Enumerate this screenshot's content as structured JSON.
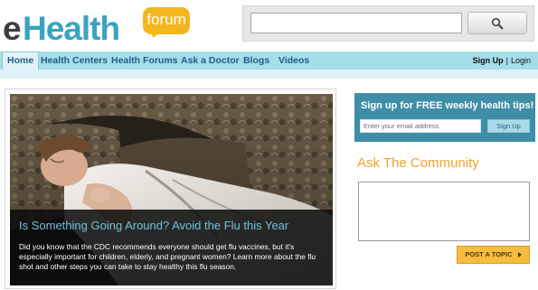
{
  "logo": {
    "prefix": "e",
    "word": "Health",
    "bubble": "forum"
  },
  "search": {
    "value": "",
    "placeholder": "",
    "icon": "search-icon"
  },
  "nav": {
    "items": [
      {
        "label": "Home",
        "active": true
      },
      {
        "label": "Health Centers"
      },
      {
        "label": "Health Forums"
      },
      {
        "label": "Ask a Doctor"
      },
      {
        "label": "Blogs"
      },
      {
        "label": "Videos"
      }
    ],
    "signup": "Sign Up",
    "separator": "|",
    "login": "Login"
  },
  "feature": {
    "title": "Is Something Going Around? Avoid the Flu this Year",
    "body": "Did you know that the CDC recommends everyone should get flu vaccines, but it's especially important for children, elderly, and pregnant women? Learn more about the flu shot and other steps you can take to stay healthy this flu season."
  },
  "newsletter": {
    "title": "Sign up for FREE weekly health tips!",
    "email_placeholder": "Enter your email address",
    "button": "Sign Up"
  },
  "community": {
    "title": "Ask The Community",
    "textarea_value": "",
    "button": "POST A TOPIC",
    "button_icon": "arrow-right-icon"
  },
  "colors": {
    "brand_blue": "#3aa3c0",
    "nav_bg": "#a5dde9",
    "nav_text": "#1f5f86",
    "accent_orange": "#f0a32a",
    "signup_bg": "#3f8ea8",
    "button_yellow": "#f6bc3b"
  }
}
